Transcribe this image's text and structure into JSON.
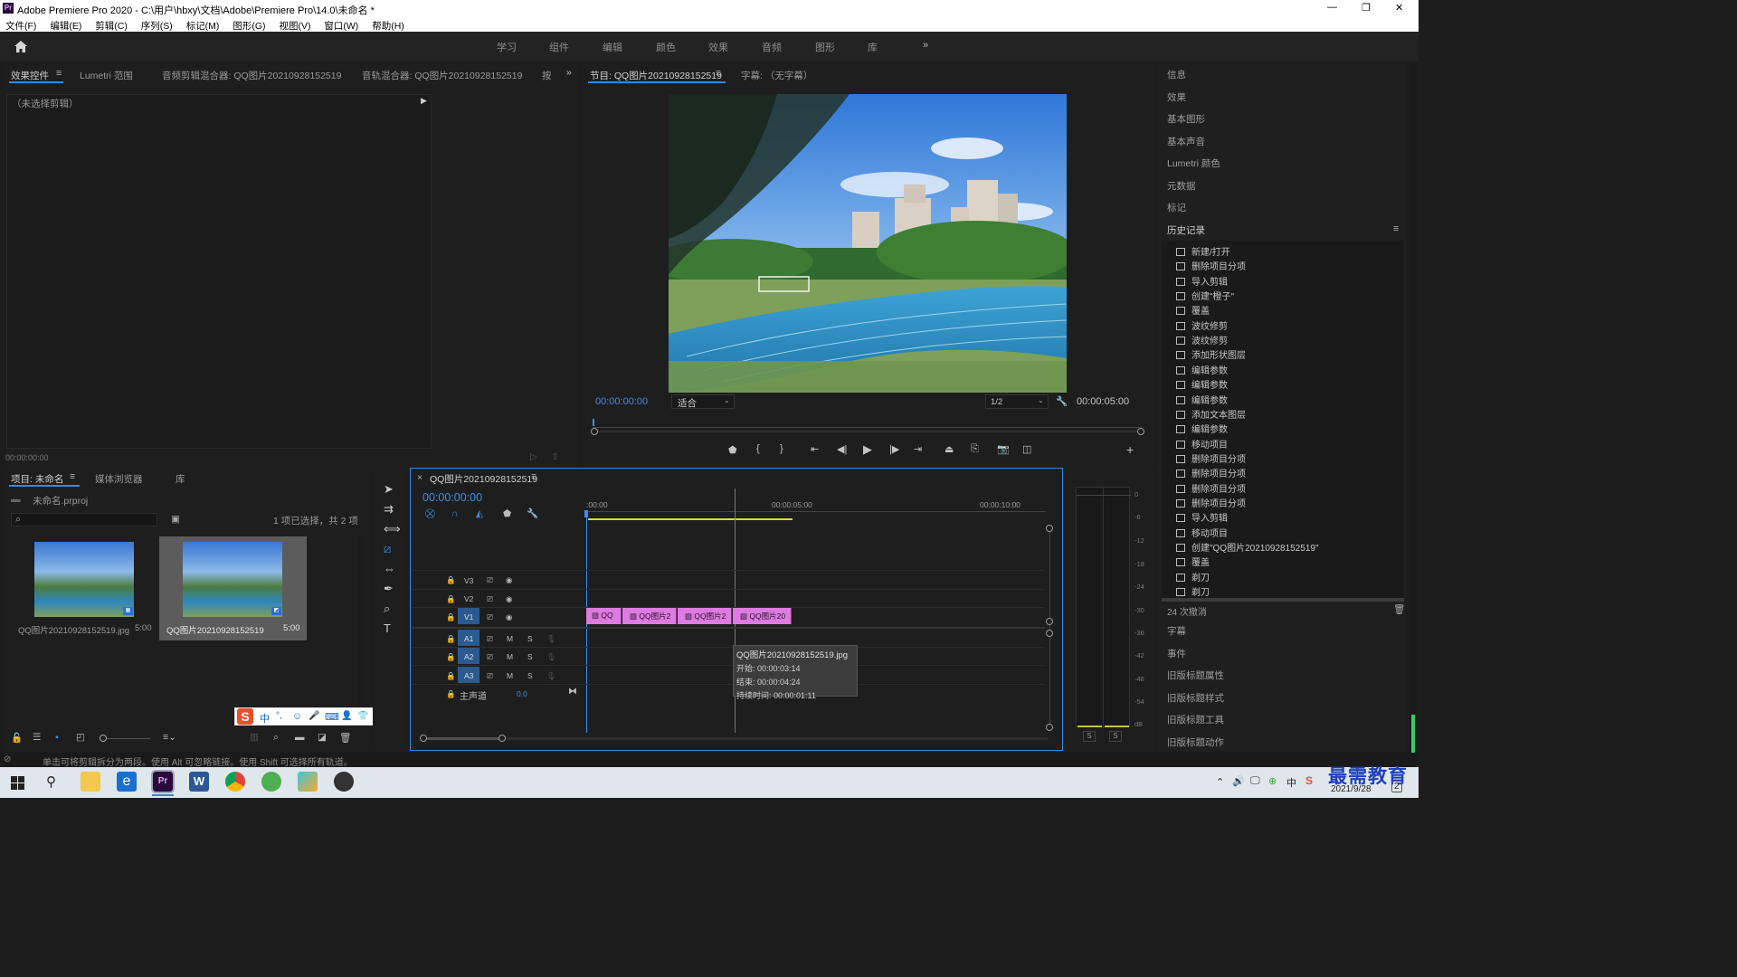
{
  "app": {
    "title": "Adobe Premiere Pro 2020 - C:\\用户\\hbxy\\文档\\Adobe\\Premiere Pro\\14.0\\未命名 *",
    "logo": "Pr"
  },
  "window_controls": [
    "—",
    "❐",
    "✕"
  ],
  "menu": [
    "文件(F)",
    "编辑(E)",
    "剪辑(C)",
    "序列(S)",
    "标记(M)",
    "图形(G)",
    "视图(V)",
    "窗口(W)",
    "帮助(H)"
  ],
  "workspaces": [
    "学习",
    "组件",
    "编辑",
    "颜色",
    "效果",
    "音频",
    "图形",
    "库"
  ],
  "source_panel": {
    "tabs": [
      "效果控件",
      "Lumetri 范围",
      "音频剪辑混合器: QQ图片20210928152519",
      "音轨混合器: QQ图片20210928152519",
      "按"
    ],
    "no_clip": "（未选择剪辑）",
    "timecode": "00:00:00:00"
  },
  "program": {
    "tabs": [
      "节目: QQ图片20210928152519",
      "字幕: （无字幕）"
    ],
    "timecode": "00:00:00:00",
    "fit": "适合",
    "resolution": "1/2",
    "duration": "00:00:05:00"
  },
  "right_panels": {
    "top": [
      "信息",
      "效果",
      "基本图形",
      "基本声音",
      "Lumetri 颜色",
      "元数据",
      "标记"
    ],
    "history_title": "历史记录",
    "history": [
      "新建/打开",
      "删除项目分项",
      "导入剪辑",
      "创建\"橙子\"",
      "覆盖",
      "波纹修剪",
      "波纹修剪",
      "添加形状图层",
      "编辑参数",
      "编辑参数",
      "编辑参数",
      "添加文本图层",
      "编辑参数",
      "移动项目",
      "删除项目分项",
      "删除项目分项",
      "删除项目分项",
      "删除项目分项",
      "导入剪辑",
      "移动项目",
      "创建\"QQ图片20210928152519\"",
      "覆盖",
      "剃刀",
      "剃刀"
    ],
    "undo_count": "24 次撤消",
    "bottom": [
      "字幕",
      "事件",
      "旧版标题属性",
      "旧版标题样式",
      "旧版标题工具",
      "旧版标题动作"
    ]
  },
  "project": {
    "tabs": [
      "项目: 未命名",
      "媒体浏览器",
      "库"
    ],
    "file": "未命名.prproj",
    "selection": "1 项已选择，共 2 项",
    "items": [
      {
        "name": "QQ图片20210928152519.jpg",
        "duration": "5:00"
      },
      {
        "name": "QQ图片20210928152519",
        "duration": "5:00"
      }
    ]
  },
  "timeline": {
    "tab": "QQ图片20210928152519",
    "timecode": "00:00:00:00",
    "ruler": [
      ":00:00",
      "00:00:05:00",
      "00:00:10:00"
    ],
    "video_tracks": [
      "V3",
      "V2",
      "V1"
    ],
    "audio_tracks": [
      "A1",
      "A2",
      "A3"
    ],
    "master": "主声道",
    "master_value": "0.0",
    "clips": [
      "QQ",
      "QQ图片2",
      "QQ图片2",
      "QQ图片20"
    ],
    "tooltip": {
      "name": "QQ图片20210928152519.jpg",
      "start": "开始: 00:00:03:14",
      "end": "结束: 00:00:04:24",
      "duration": "持续时间: 00:00:01:11"
    }
  },
  "meter_scale": [
    "0",
    "-6",
    "-12",
    "-18",
    "-24",
    "-30",
    "-36",
    "-42",
    "-48",
    "-54",
    "dB"
  ],
  "meter_solo": [
    "S",
    "S"
  ],
  "status": "单击可将剪辑拆分为两段。使用 Alt 可忽略链接。使用 Shift 可选择所有轨道。",
  "ime": [
    "中",
    "°,",
    "☺",
    "🎤",
    "⌨",
    "👤",
    "👕",
    "▦"
  ],
  "watermark": "最需教育",
  "taskbar": {
    "date": "2021/9/28",
    "badge": "2"
  },
  "colors": {
    "accent": "#2d8ceb",
    "clip": "#dd7be0",
    "timecode": "#3d8fe8",
    "playhead": "#3d8fe8"
  }
}
